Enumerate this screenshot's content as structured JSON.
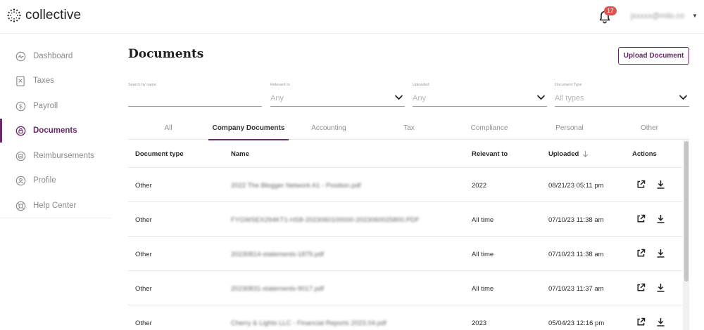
{
  "app": {
    "name": "collective"
  },
  "topbar": {
    "notification_count": "17",
    "user_email": "jxxxxx@milo.co"
  },
  "sidebar": {
    "items": [
      {
        "label": "Dashboard",
        "icon": "activity-icon",
        "active": false
      },
      {
        "label": "Taxes",
        "icon": "receipt-icon",
        "active": false
      },
      {
        "label": "Payroll",
        "icon": "dollar-circle-icon",
        "active": false
      },
      {
        "label": "Documents",
        "icon": "document-lock-icon",
        "active": true
      },
      {
        "label": "Reimbursements",
        "icon": "reimburse-icon",
        "active": false
      },
      {
        "label": "Profile",
        "icon": "user-circle-icon",
        "active": false
      },
      {
        "label": "Help Center",
        "icon": "lifebuoy-icon",
        "active": false
      }
    ]
  },
  "page": {
    "title": "Documents",
    "upload_label": "Upload Document"
  },
  "filters": {
    "search": {
      "label": "Search by name",
      "value": ""
    },
    "relevant": {
      "label": "Relevant to",
      "value": "Any"
    },
    "uploaded": {
      "label": "Uploaded",
      "value": "Any"
    },
    "doctype": {
      "label": "Document Type",
      "value": "All types"
    }
  },
  "tabs": [
    {
      "label": "All",
      "active": false
    },
    {
      "label": "Company Documents",
      "active": true
    },
    {
      "label": "Accounting",
      "active": false
    },
    {
      "label": "Tax",
      "active": false
    },
    {
      "label": "Compliance",
      "active": false
    },
    {
      "label": "Personal",
      "active": false
    },
    {
      "label": "Other",
      "active": false
    }
  ],
  "table": {
    "headers": {
      "doc_type": "Document type",
      "name": "Name",
      "relevant": "Relevant to",
      "uploaded": "Uploaded",
      "actions": "Actions"
    },
    "sort_icon": "arrow-down-icon",
    "rows": [
      {
        "doc_type": "Other",
        "name": "2022 The Blogger Network A1 - Position.pdf",
        "relevant": "2022",
        "uploaded": "08/21/23 05:11 pm"
      },
      {
        "doc_type": "Other",
        "name": "FYGWSEX294KT1-HS8-2023060100000-2023060025800.PDF",
        "relevant": "All time",
        "uploaded": "07/10/23 11:38 am"
      },
      {
        "doc_type": "Other",
        "name": "20230814-statements-1879.pdf",
        "relevant": "All time",
        "uploaded": "07/10/23 11:38 am"
      },
      {
        "doc_type": "Other",
        "name": "20230831-statements-9017.pdf",
        "relevant": "All time",
        "uploaded": "07/10/23 11:37 am"
      },
      {
        "doc_type": "Other",
        "name": "Cherry & Lights LLC - Financial Reports 2023.04.pdf",
        "relevant": "2023",
        "uploaded": "05/04/23 12:16 pm"
      }
    ]
  },
  "colors": {
    "accent": "#6a2a6a",
    "badge": "#e0524f",
    "muted": "#8a8a8a"
  }
}
